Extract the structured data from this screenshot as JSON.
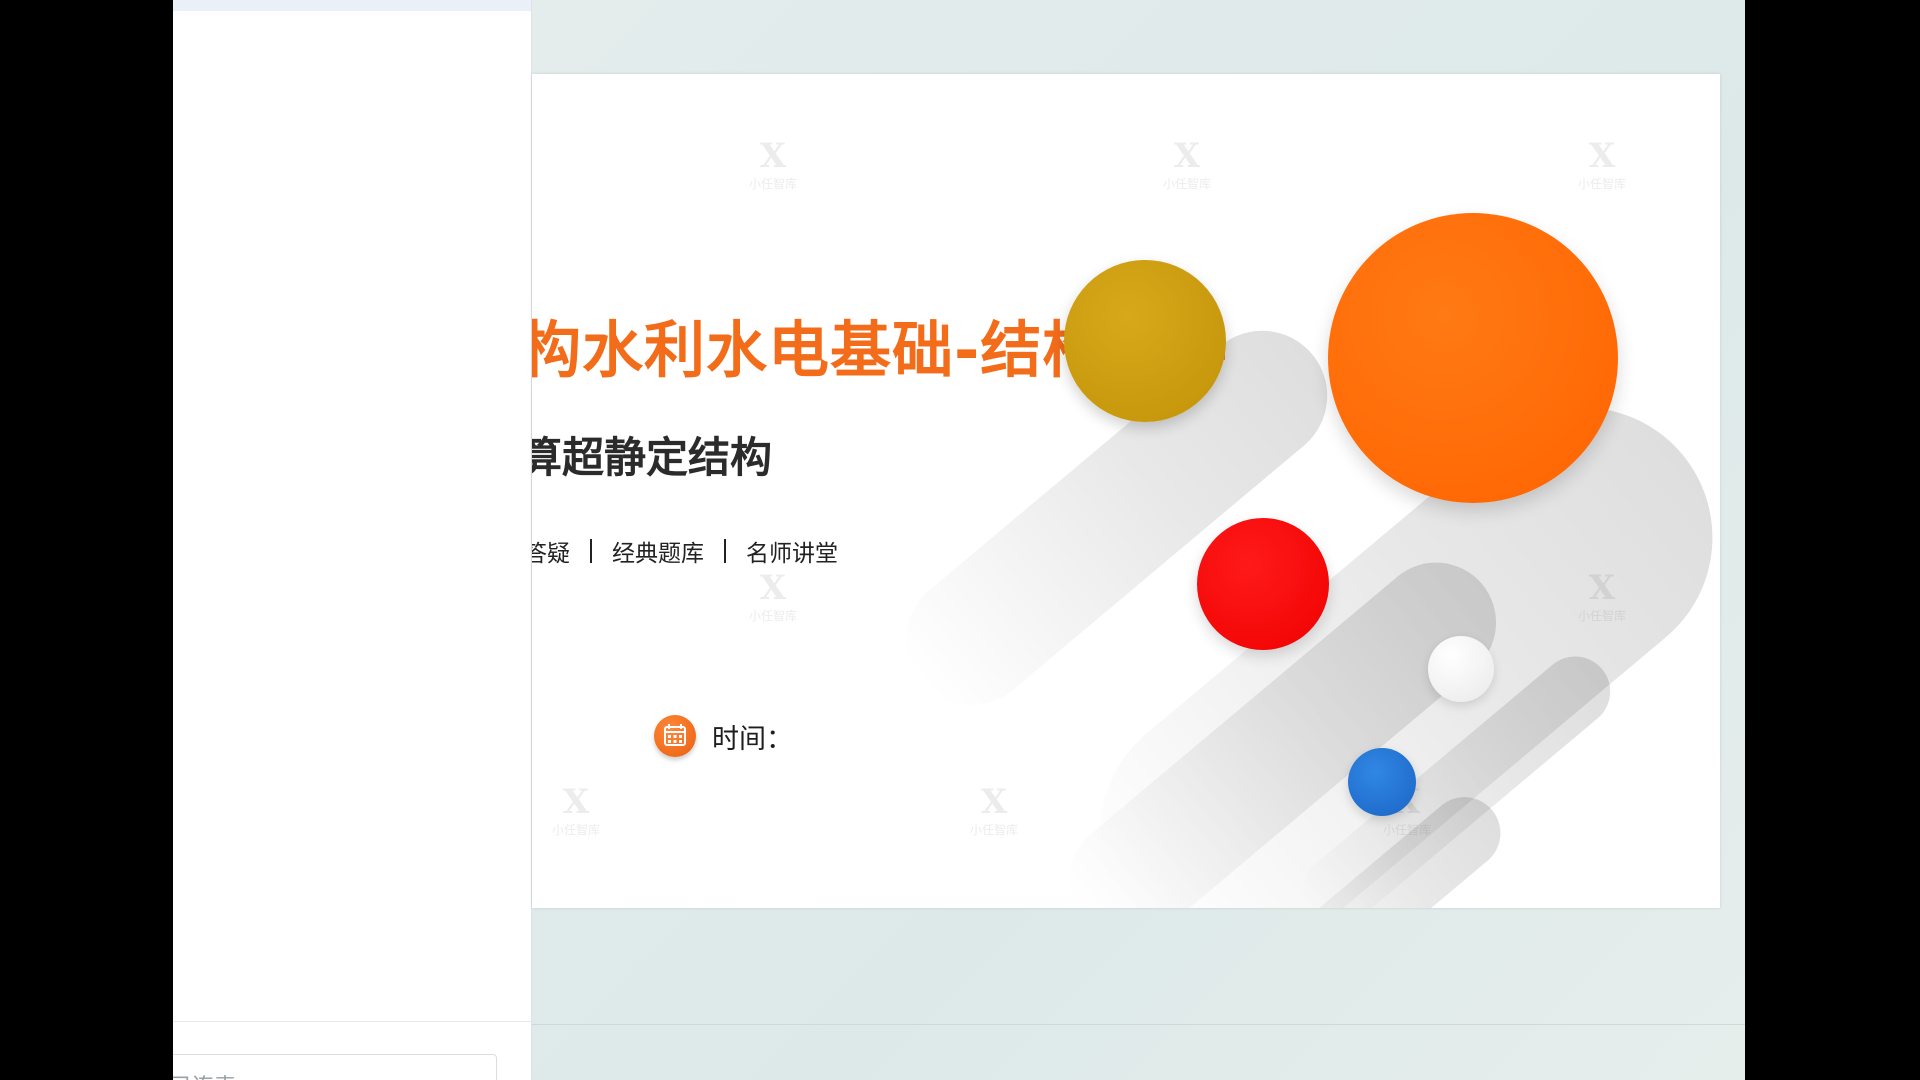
{
  "side_panel": {
    "input_partial_text": "已连表"
  },
  "slide": {
    "title": "构水利水电基础-结构力学",
    "subtitle": "算超静定结构",
    "tags": [
      "答疑",
      "经典题库",
      "名师讲堂"
    ],
    "time_label": "时间：",
    "watermark_text": "小任智库",
    "watermark_glyph": "X",
    "icons": {
      "calendar": "calendar-icon"
    },
    "colors": {
      "title": "#f36c1a",
      "circle_gold": "#c99a0a",
      "circle_orange": "#ff6a00",
      "circle_red": "#ff0000",
      "circle_white": "#f2f2f2",
      "circle_blue": "#1e6fd1"
    }
  }
}
